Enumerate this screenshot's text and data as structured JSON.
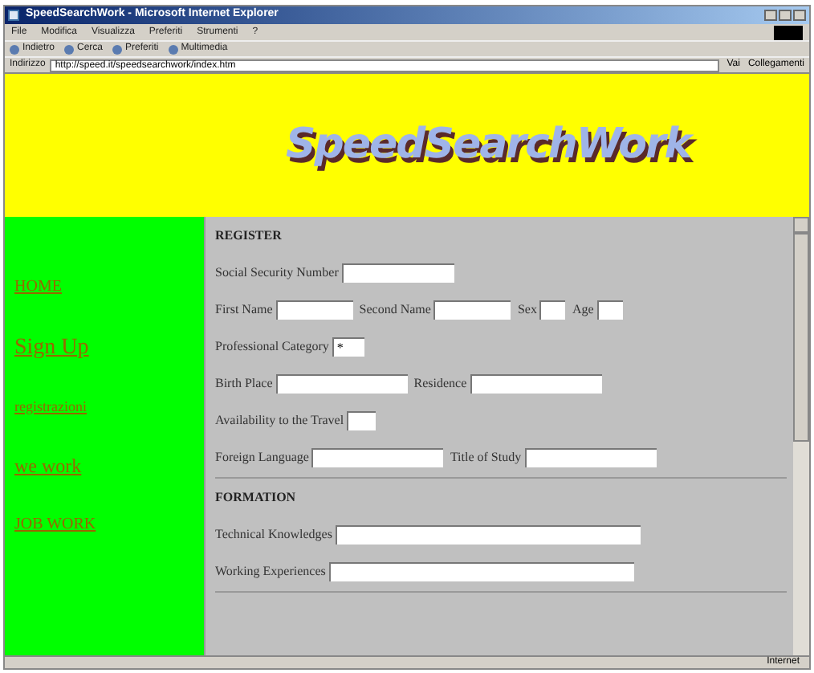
{
  "window": {
    "title": "SpeedSearchWork - Microsoft Internet Explorer"
  },
  "menu": [
    "File",
    "Modifica",
    "Visualizza",
    "Preferiti",
    "Strumenti",
    "?"
  ],
  "toolbar": [
    {
      "label": "Indietro"
    },
    {
      "label": "Cerca"
    },
    {
      "label": "Preferiti"
    },
    {
      "label": "Multimedia"
    }
  ],
  "address": {
    "label": "Indirizzo",
    "value": "http://speed.it/speedsearchwork/index.htm",
    "go": "Vai",
    "links": "Collegamenti"
  },
  "banner": {
    "logo": "SpeedSearchWork"
  },
  "sidebar": [
    {
      "label": "HOME"
    },
    {
      "label": "Sign Up"
    },
    {
      "label": "registrazioni"
    },
    {
      "label": "we work"
    },
    {
      "label": "JOB WORK"
    }
  ],
  "sections": [
    {
      "title": "REGISTER",
      "rows": [
        [
          {
            "label": "Social Security Number",
            "kind": "text"
          }
        ],
        [
          {
            "label": "First Name",
            "kind": "text"
          },
          {
            "label": "Second Name",
            "kind": "text"
          },
          {
            "label": "Sex",
            "kind": "text"
          },
          {
            "label": "Age",
            "kind": "text"
          }
        ],
        [
          {
            "label": "Professional Category",
            "kind": "select",
            "value": "*"
          }
        ],
        [
          {
            "label": "Birth Place",
            "kind": "text"
          },
          {
            "label": "Residence",
            "kind": "text"
          }
        ],
        [
          {
            "label": "Availability to the Travel",
            "kind": "text"
          }
        ],
        [
          {
            "label": "Foreign Language",
            "kind": "text"
          },
          {
            "label": "Title of Study",
            "kind": "text"
          }
        ]
      ]
    },
    {
      "title": "FORMATION",
      "rows": [
        [
          {
            "label": "Technical Knowledges",
            "kind": "text"
          }
        ],
        [
          {
            "label": "Working Experiences",
            "kind": "text"
          }
        ]
      ]
    }
  ],
  "status_bar": {
    "zone": "Internet"
  }
}
